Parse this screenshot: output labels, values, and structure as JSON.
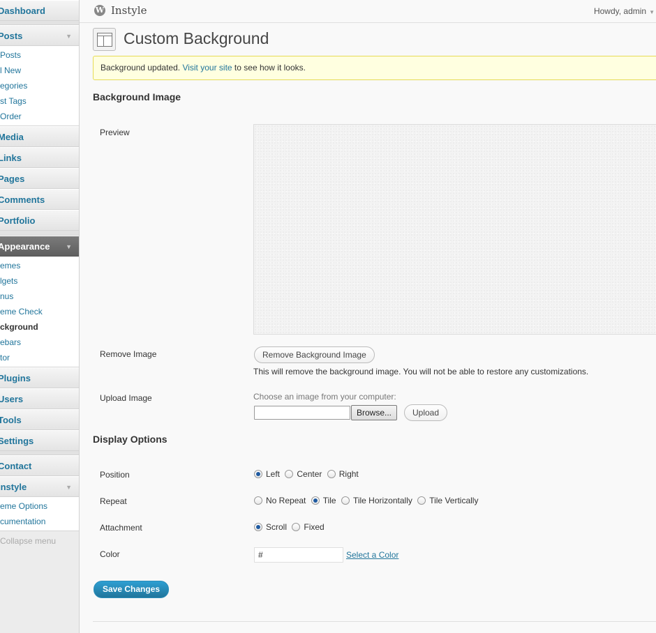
{
  "sidebar": {
    "top": [
      {
        "label": "Dashboard",
        "arrow": false
      },
      {
        "label": "Posts",
        "arrow": true,
        "submenu": [
          "Posts",
          "l New",
          "egories",
          "st Tags",
          "Order"
        ]
      },
      {
        "label": "Media"
      },
      {
        "label": "Links"
      },
      {
        "label": "Pages"
      },
      {
        "label": "Comments"
      },
      {
        "label": "Portfolio"
      },
      {
        "label": "Appearance",
        "current": true,
        "submenu": [
          "emes",
          "lgets",
          "nus",
          "eme Check",
          "ckground",
          "ebars",
          "tor"
        ]
      },
      {
        "label": "Plugins"
      },
      {
        "label": "Users"
      },
      {
        "label": "Tools"
      },
      {
        "label": "Settings"
      },
      {
        "label": "Contact"
      },
      {
        "label": "Instyle",
        "submenu": [
          "eme Options",
          "cumentation"
        ]
      }
    ],
    "labels": {
      "dashboard": "Dashboard",
      "posts": "Posts",
      "posts_sub": [
        "Posts",
        "l New",
        "egories",
        "st Tags",
        "Order"
      ],
      "media": "Media",
      "links": "Links",
      "pages": "Pages",
      "comments": "Comments",
      "portfolio": "Portfolio",
      "appearance": "Appearance",
      "appearance_sub": [
        "emes",
        "lgets",
        "nus",
        "eme Check",
        "ckground",
        "ebars",
        "tor"
      ],
      "plugins": "Plugins",
      "users": "Users",
      "tools": "Tools",
      "settings": "Settings",
      "contact": "Contact",
      "instyle": "Instyle",
      "instyle_sub": [
        "eme Options",
        "cumentation"
      ],
      "collapse": "Collapse menu"
    }
  },
  "header": {
    "site_title": "Instyle",
    "howdy": "Howdy, admin"
  },
  "page": {
    "title": "Custom Background",
    "notice_text": "Background updated.",
    "notice_link": "Visit your site",
    "notice_after": "to see how it looks."
  },
  "background_image": {
    "heading": "Background Image",
    "preview_label": "Preview",
    "remove_label": "Remove Image",
    "remove_button": "Remove Background Image",
    "remove_desc": "This will remove the background image. You will not be able to restore any customizations.",
    "upload_label": "Upload Image",
    "choose_text": "Choose an image from your computer:",
    "browse_button": "Browse...",
    "upload_button": "Upload"
  },
  "display_options": {
    "heading": "Display Options",
    "position_label": "Position",
    "position_options": [
      "Left",
      "Center",
      "Right"
    ],
    "position_selected": "Left",
    "repeat_label": "Repeat",
    "repeat_options": [
      "No Repeat",
      "Tile",
      "Tile Horizontally",
      "Tile Vertically"
    ],
    "repeat_selected": "Tile",
    "attachment_label": "Attachment",
    "attachment_options": [
      "Scroll",
      "Fixed"
    ],
    "attachment_selected": "Scroll",
    "color_label": "Color",
    "color_value": "#",
    "select_color": "Select a Color"
  },
  "save_button": "Save Changes",
  "colors": {
    "link": "#21759b",
    "notice_bg": "#ffffe0",
    "notice_border": "#e6db55",
    "primary_button": "#21759b"
  }
}
